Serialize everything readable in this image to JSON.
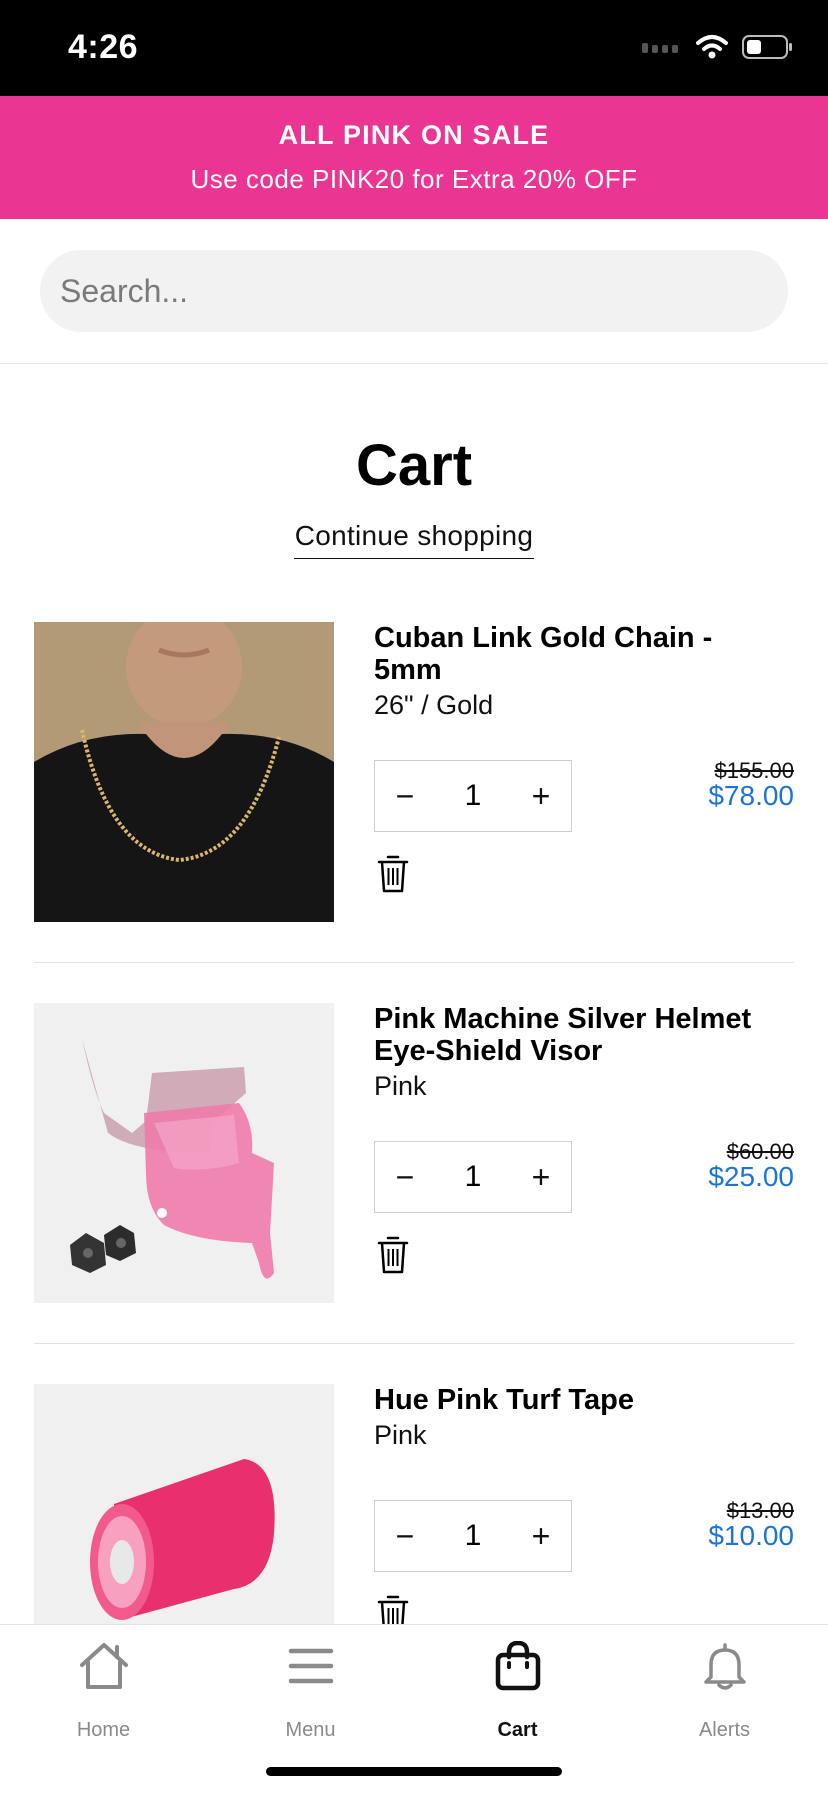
{
  "status_bar": {
    "time": "4:26"
  },
  "promo": {
    "title": "ALL PINK ON SALE",
    "subtitle": "Use code PINK20 for Extra 20% OFF",
    "background": "#ea3592"
  },
  "search": {
    "placeholder": "Search..."
  },
  "page": {
    "title": "Cart",
    "continue_label": "Continue shopping"
  },
  "cart": {
    "items": [
      {
        "title": "Cuban Link Gold Chain - 5mm",
        "variant": "26\" / Gold",
        "quantity": "1",
        "compare_price": "$155.00",
        "price": "$78.00"
      },
      {
        "title": "Pink Machine Silver Helmet Eye-Shield Visor",
        "variant": "Pink",
        "quantity": "1",
        "compare_price": "$60.00",
        "price": "$25.00"
      },
      {
        "title": "Hue Pink Turf Tape",
        "variant": "Pink",
        "quantity": "1",
        "compare_price": "$13.00",
        "price": "$10.00"
      }
    ],
    "minus_symbol": "−",
    "plus_symbol": "+"
  },
  "tabs": [
    {
      "label": "Home",
      "icon": "home-icon",
      "active": false
    },
    {
      "label": "Menu",
      "icon": "menu-icon",
      "active": false
    },
    {
      "label": "Cart",
      "icon": "bag-icon",
      "active": true
    },
    {
      "label": "Alerts",
      "icon": "bell-icon",
      "active": false
    }
  ],
  "colors": {
    "accent_price": "#1d74d6",
    "promo": "#ea3592"
  }
}
